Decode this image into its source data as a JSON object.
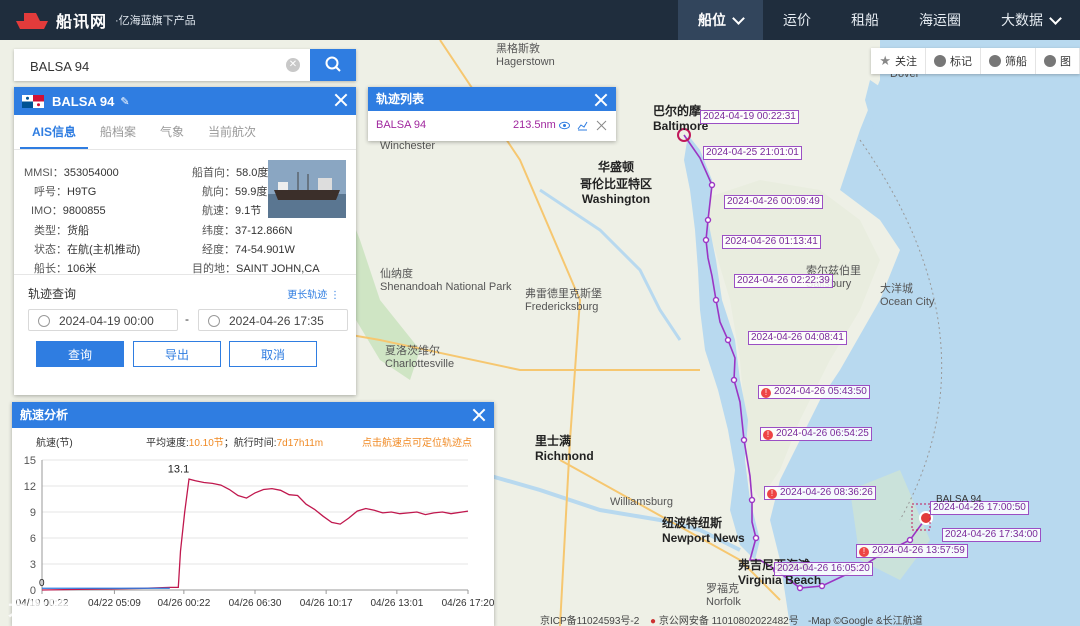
{
  "header": {
    "logo_text": "船讯网",
    "logo_sub": "·亿海蓝旗下产品",
    "nav": [
      {
        "label": "船位",
        "active": true,
        "dropdown": true
      },
      {
        "label": "运价",
        "active": false,
        "dropdown": false
      },
      {
        "label": "租船",
        "active": false,
        "dropdown": false
      },
      {
        "label": "海运圈",
        "active": false,
        "dropdown": false
      },
      {
        "label": "大数据",
        "active": false,
        "dropdown": true
      }
    ]
  },
  "toolbar": {
    "follow": "关注",
    "mark": "标记",
    "filter": "筛船",
    "layer": "图"
  },
  "search": {
    "value": "BALSA 94"
  },
  "ship_panel": {
    "title": "BALSA 94",
    "tabs": [
      "AIS信息",
      "船档案",
      "气象",
      "当前航次"
    ],
    "fields": {
      "mmsi_label": "MMSI：",
      "mmsi": "353054000",
      "callsign_label": "呼号：",
      "callsign": "H9TG",
      "imo_label": "IMO：",
      "imo": "9800855",
      "type_label": "类型：",
      "type": "货船",
      "status_label": "状态：",
      "status": "在航(主机推动)",
      "length_label": "船长：",
      "length": "106米",
      "heading_label": "船首向：",
      "heading": "58.0度",
      "course_label": "航向：",
      "course": "59.9度",
      "speed_label": "航速：",
      "speed": "9.1节",
      "lat_label": "纬度：",
      "lat": "37-12.866N",
      "lon_label": "经度：",
      "lon": "74-54.901W",
      "dest_label": "目的地：",
      "dest": "SAINT JOHN,CA"
    },
    "track_query": {
      "title": "轨迹查询",
      "more": "更长轨迹",
      "start": "2024-04-19 00:00",
      "end": "2024-04-26 17:35",
      "dash": "-",
      "query_btn": "查询",
      "export_btn": "导出",
      "cancel_btn": "取消"
    }
  },
  "track_list": {
    "title": "轨迹列表",
    "ship": "BALSA 94",
    "distance": "213.5nm"
  },
  "speed_panel": {
    "title": "航速分析",
    "y_label": "航速(节)",
    "avg_label": "平均速度:",
    "avg_value": "10.10节",
    "time_label": "；航行时间:",
    "time_value": "7d17h11m",
    "hint": "点击航速点可定位轨迹点"
  },
  "chart_data": {
    "type": "line",
    "ylabel": "航速(节)",
    "ylim": [
      0,
      15
    ],
    "y_ticks": [
      0,
      3,
      6,
      9,
      12,
      15
    ],
    "x_ticks": [
      "04/19 00:22",
      "04/22 05:09",
      "04/26 00:22",
      "04/26 06:30",
      "04/26 10:17",
      "04/26 13:01",
      "04/26 17:20"
    ],
    "max_label": "13.1",
    "zero_label": "0",
    "series": [
      {
        "color": "#c0184e",
        "x": [
          0,
          0.12,
          0.24,
          0.3,
          0.32,
          0.325,
          0.335,
          0.345,
          0.36,
          0.38,
          0.4,
          0.42,
          0.44,
          0.46,
          0.48,
          0.5,
          0.52,
          0.54,
          0.56,
          0.58,
          0.6,
          0.62,
          0.64,
          0.66,
          0.68,
          0.7,
          0.72,
          0.74,
          0.76,
          0.78,
          0.8,
          0.82,
          0.84,
          0.86,
          0.88,
          0.9,
          0.92,
          0.94,
          0.96,
          1.0
        ],
        "y": [
          0,
          0.1,
          0.2,
          0.3,
          0.3,
          4.5,
          9.0,
          12.8,
          12.6,
          12.4,
          12.3,
          12.1,
          11.6,
          10.9,
          10.6,
          11.2,
          11.6,
          11.7,
          11.5,
          11.0,
          10.9,
          9.9,
          9.3,
          8.5,
          7.8,
          7.6,
          8.3,
          9.1,
          9.4,
          9.2,
          8.9,
          9.0,
          8.8,
          8.9,
          9.0,
          8.7,
          8.9,
          9.0,
          8.8,
          9.1
        ]
      }
    ]
  },
  "track_points": [
    "2024-04-19 00:22:31",
    "2024-04-25 21:01:01",
    "2024-04-26 00:09:49",
    "2024-04-26 01:13:41",
    "2024-04-26 02:22:39",
    "2024-04-26 04:08:41",
    "2024-04-26 05:43:50",
    "2024-04-26 06:54:25",
    "2024-04-26 08:36:26",
    "2024-04-26 13:57:59",
    "2024-04-26 16:05:20",
    "2024-04-26 17:00:50",
    "2024-04-26 17:34:00"
  ],
  "map_labels": {
    "hagerstown_cn": "黑格斯敦",
    "hagerstown": "Hagerstown",
    "baltimore_cn": "巴尔的摩",
    "baltimore": "Baltimore",
    "washington_cn1": "华盛顿",
    "washington_cn2": "哥伦比亚特区",
    "washington": "Washington",
    "richmond_cn": "里士满",
    "richmond": "Richmond",
    "newport_cn": "纽波特纽斯",
    "newport": "Newport News",
    "vb_cn": "弗吉尼亚海滩",
    "vb": "Virginia Beach",
    "norfolk_cn": "罗福克",
    "norfolk": "Norfolk",
    "charlottesville_cn": "夏洛茨维尔",
    "charlottesville": "Charlottesville",
    "fredericksburg_cn": "弗雷德里克斯堡",
    "fredericksburg": "Fredericksburg",
    "salisbury_cn": "索尔兹伯里",
    "salisbury": "Salisbury",
    "ocean_city_cn": "大洋城",
    "ocean_city": "Ocean City",
    "shenandoah_cn": "仙纳度",
    "shenandoah": "Shenandoah National Park",
    "williamsburg": "Williamsburg",
    "winchester": "Winchester",
    "dover": "Dover",
    "ship_tag": "BALSA 94"
  },
  "footer": {
    "icp": "京ICP备11024593号-2",
    "police": "京公网安备 11010802022482号",
    "map": "-Map ©Google &长江航道",
    "watermark": "大数跨境"
  }
}
